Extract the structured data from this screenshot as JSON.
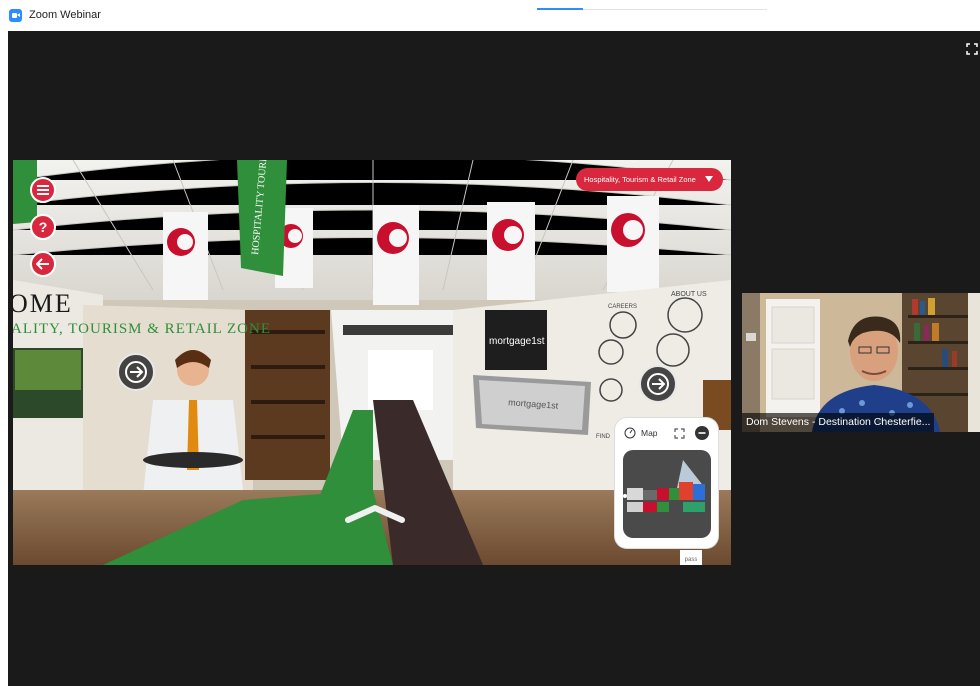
{
  "window": {
    "title": "Zoom Webinar"
  },
  "share": {
    "zone_selector": "Hospitality, Tourism & Retail Zone",
    "menu_icon": "hamburger-icon",
    "help_icon": "question-icon",
    "back_icon": "arrow-left-icon",
    "hall_title": "OME",
    "hall_subtitle": "ALITY, TOURISM & RETAIL ZONE",
    "banner_text": "HOSPITALITY TOURISM &",
    "booth_logo": "mortgage1st",
    "booth_screen_text": "mortgage1st",
    "wall_labels": {
      "careers": "CAREERS",
      "about": "ABOUT US",
      "find": "FIND"
    },
    "map": {
      "label": "Map"
    },
    "watermark": "pass studio"
  },
  "participant": {
    "name": "Dom Stevens - Destination Chesterfie..."
  },
  "colors": {
    "accent_red": "#d9283d",
    "zoom_blue": "#2d8cff",
    "meeting_bg": "#1a1a1a",
    "carpet_green": "#2f8f3a"
  }
}
